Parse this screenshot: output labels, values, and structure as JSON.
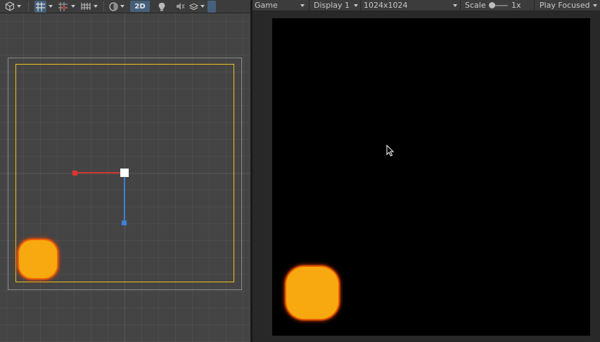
{
  "scene": {
    "toolbar": {
      "icons": [
        "gizmo-cube-icon",
        "grid-snap-icon",
        "increment-snap-icon",
        "grid-visibility-icon",
        "shading-sphere-icon",
        "lighting-icon",
        "audio-icon",
        "effects-icon"
      ],
      "mode_2d_label": "2D"
    }
  },
  "game": {
    "toolbar": {
      "view_label": "Game",
      "display_label": "Display 1",
      "resolution_label": "1024x1024",
      "scale_label": "Scale",
      "scale_value": "1x",
      "play_mode_label": "Play Focused"
    }
  },
  "colors": {
    "camera_frame": "#f0c419",
    "sprite_fill": "#f7a90f",
    "sprite_glow": "#ff6a00",
    "x_axis": "#d0342c",
    "y_axis": "#3f7fd8",
    "toolbar_active": "#46607c"
  }
}
